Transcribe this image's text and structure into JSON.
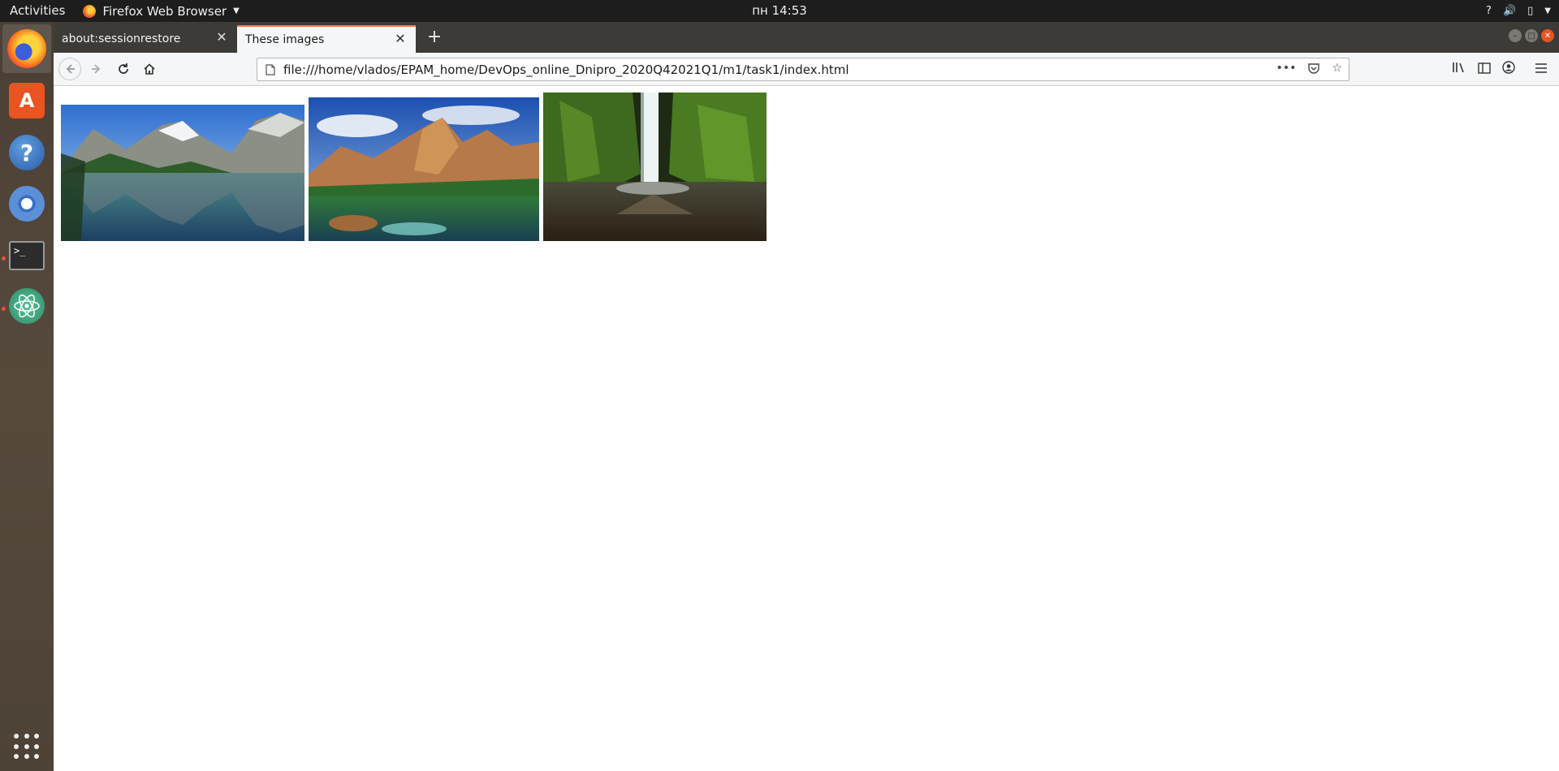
{
  "topbar": {
    "activities": "Activities",
    "app_name": "Firefox Web Browser",
    "clock": "пн 14:53"
  },
  "dock": {
    "items": [
      "firefox",
      "software-center",
      "help",
      "chromium",
      "terminal",
      "atom",
      "show-applications"
    ]
  },
  "tabs": [
    {
      "title": "about:sessionrestore",
      "active": false
    },
    {
      "title": "These images",
      "active": true
    }
  ],
  "navbar": {
    "url": "file:///home/vlados/EPAM_home/DevOps_online_Dnipro_2020Q42021Q1/m1/task1/index.html",
    "more_label": "•••"
  },
  "page": {
    "images": [
      {
        "name": "mountain-lake-image"
      },
      {
        "name": "canyon-lake-image"
      },
      {
        "name": "waterfall-image"
      }
    ]
  },
  "colors": {
    "accent_tab": "#ff7139",
    "ubuntu_orange": "#e95420",
    "topbar_bg": "#1d1d1d"
  }
}
